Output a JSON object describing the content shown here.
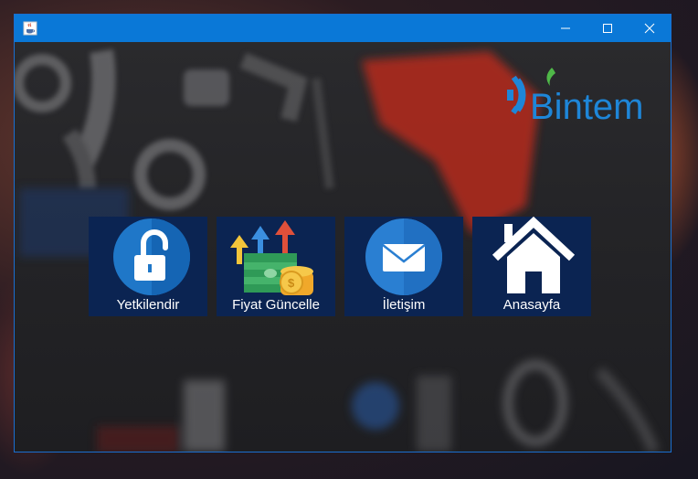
{
  "window": {
    "accent": "#0a78d7",
    "app_icon": "java-cup-icon",
    "caption_icons": [
      "minimize-icon",
      "maximize-icon",
      "close-icon"
    ]
  },
  "logo": {
    "text": "Bintem",
    "icon": "gear-flame-icon",
    "color": "#1e86d8"
  },
  "tiles": [
    {
      "label": "Yetkilendir",
      "icon": "unlock-padlock-icon"
    },
    {
      "label": "Fiyat Güncelle",
      "icon": "money-stack-arrows-icon"
    },
    {
      "label": "İletişim",
      "icon": "envelope-icon"
    },
    {
      "label": "Anasayfa",
      "icon": "home-icon"
    }
  ],
  "tile_color": "#0b2452"
}
